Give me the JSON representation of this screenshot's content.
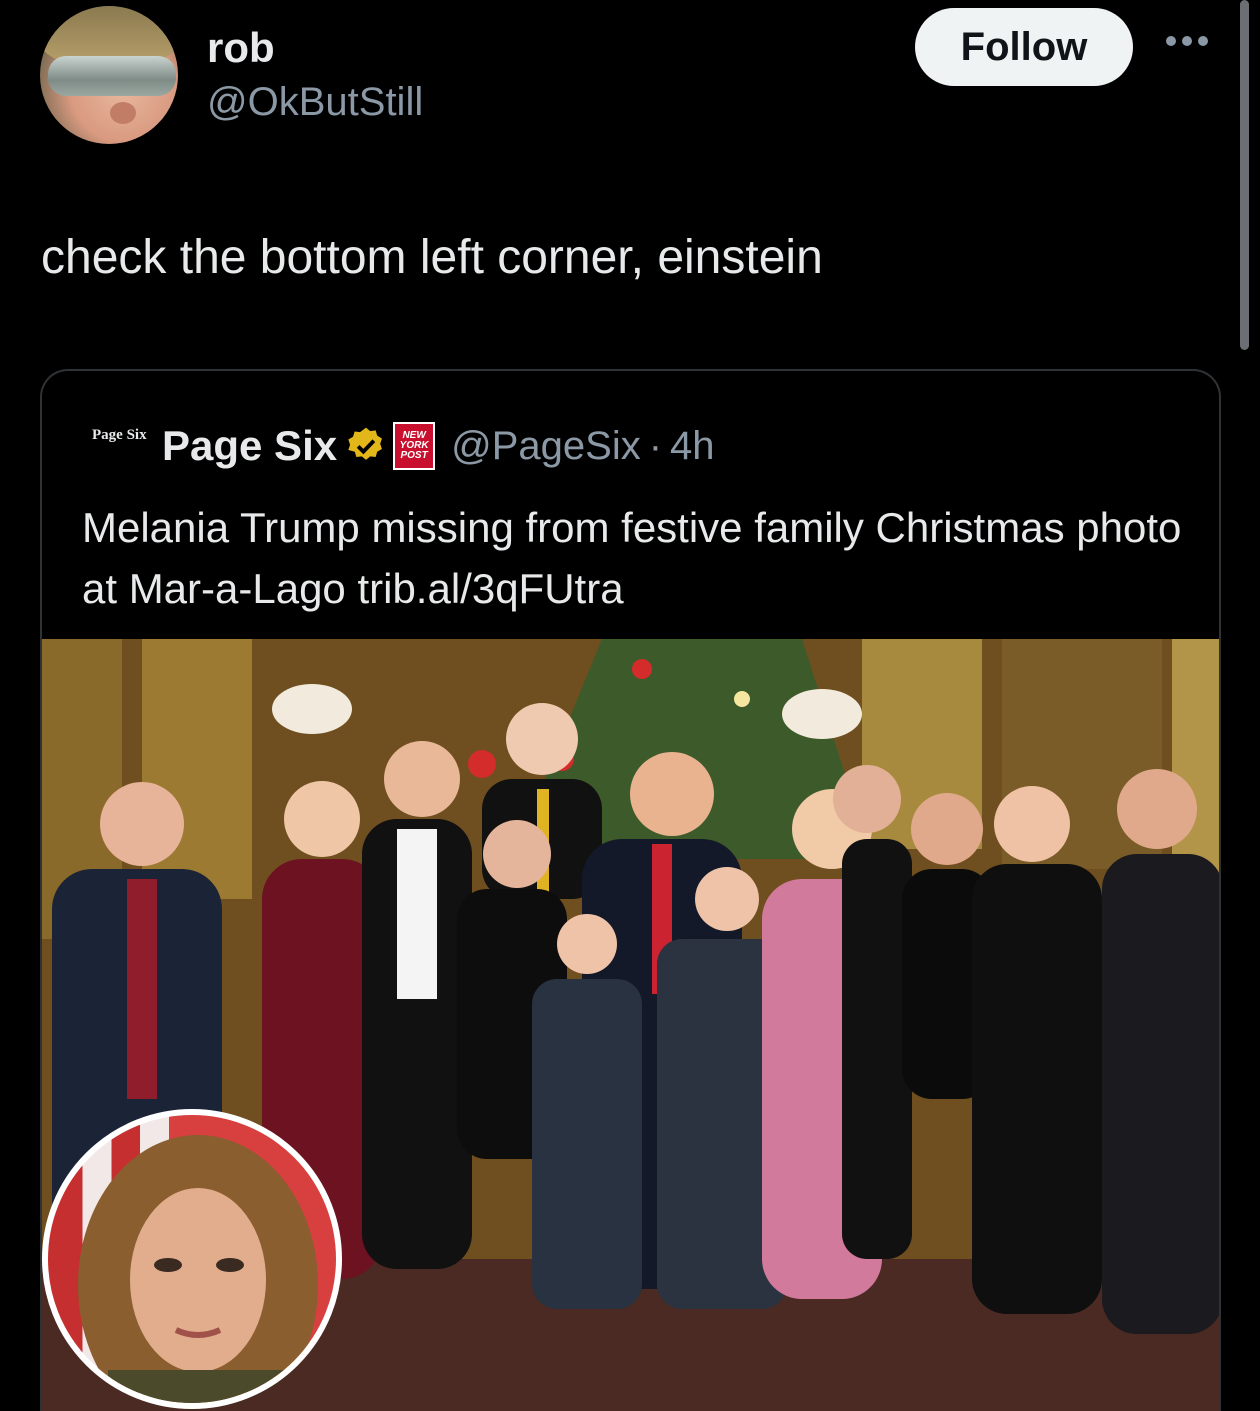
{
  "author": {
    "name": "rob",
    "handle": "@OkButStill",
    "follow_label": "Follow"
  },
  "tweet": {
    "text": "check the bottom left corner, einstein"
  },
  "quoted": {
    "logo_text": "Page Six",
    "name": "Page Six",
    "affiliate_badge_text": "NEW YORK POST",
    "handle": "@PageSix",
    "separator": "·",
    "time": "4h",
    "text": "Melania Trump missing from festive family Christmas photo at Mar-a-Lago trib.al/3qFUtra"
  },
  "colors": {
    "background": "#000000",
    "primary_text": "#e7e9ea",
    "secondary_text": "#8b98a5",
    "follow_bg": "#eff3f4",
    "verified_gold": "#e2b719",
    "nypost_red": "#c8102e",
    "border": "#2f3336"
  },
  "icons": [
    "more-icon",
    "verified-badge-icon",
    "nypost-badge-icon"
  ]
}
